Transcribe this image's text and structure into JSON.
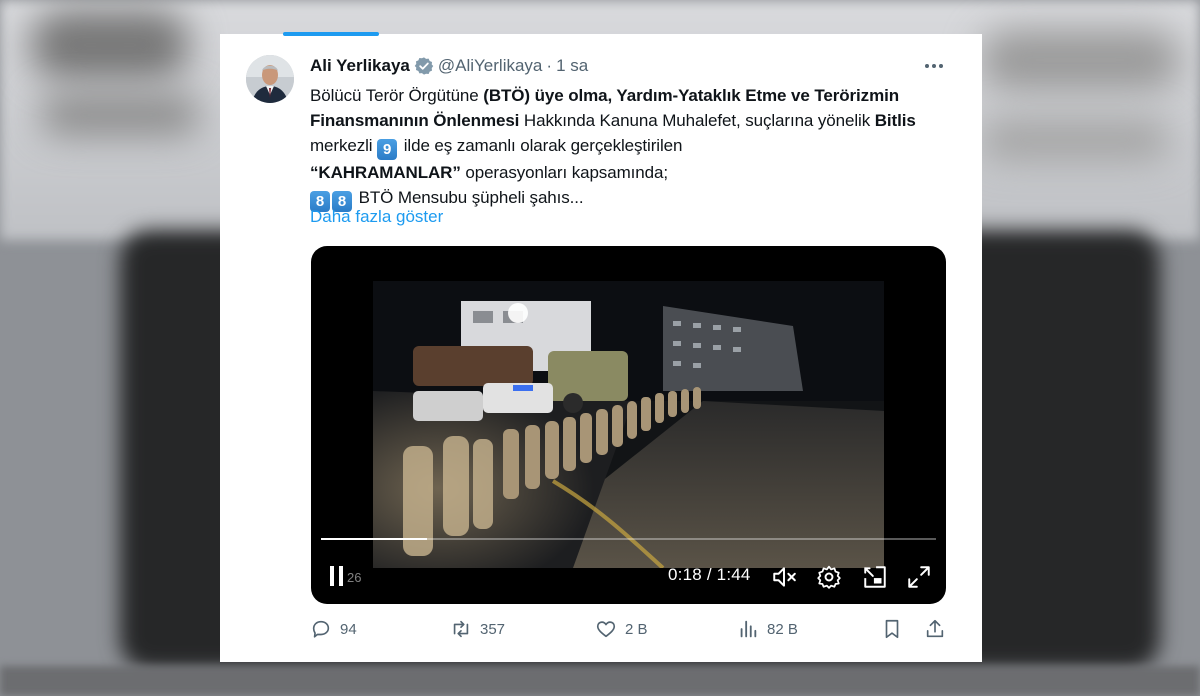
{
  "tweet": {
    "author_name": "Ali Yerlikaya",
    "handle": "@AliYerlikaya",
    "separator": "·",
    "time": "1 sa",
    "text": {
      "p1": "Bölücü Terör Örgütüne ",
      "b1": "(BTÖ) üye olma, Yardım-Yataklık Etme ve Terörizmin Finansmanının Önlenmesi",
      "p2": " Hakkında Kanuna Muhalefet, suçlarına yönelik ",
      "b2": "Bitlis",
      "p3": " merkezli ",
      "key1": "9",
      "p4": " ilde eş zamanlı olarak gerçekleştirilen ",
      "b3": "“KAHRAMANLAR”",
      "p5": " operasyonları kapsamında;",
      "key2": "8",
      "key3": "8",
      "p6": " BTÖ Mensubu şüpheli şahıs..."
    },
    "show_more": "Daha fazla göster"
  },
  "video": {
    "current_time": "0:18",
    "time_separator": " / ",
    "duration": "1:44",
    "progress": 0.173,
    "overlay_frame_number": "26"
  },
  "actions": {
    "replies": "94",
    "reposts": "357",
    "likes": "2 B",
    "views": "82 B"
  },
  "colors": {
    "accent": "#1d9bf0",
    "text": "#0f1419",
    "muted": "#536471"
  },
  "icons": [
    "verified-badge-icon",
    "more-options-icon",
    "pause-icon",
    "mute-icon",
    "settings-icon",
    "pip-icon",
    "fullscreen-icon",
    "reply-icon",
    "repost-icon",
    "like-icon",
    "views-icon",
    "bookmark-icon",
    "share-icon"
  ]
}
